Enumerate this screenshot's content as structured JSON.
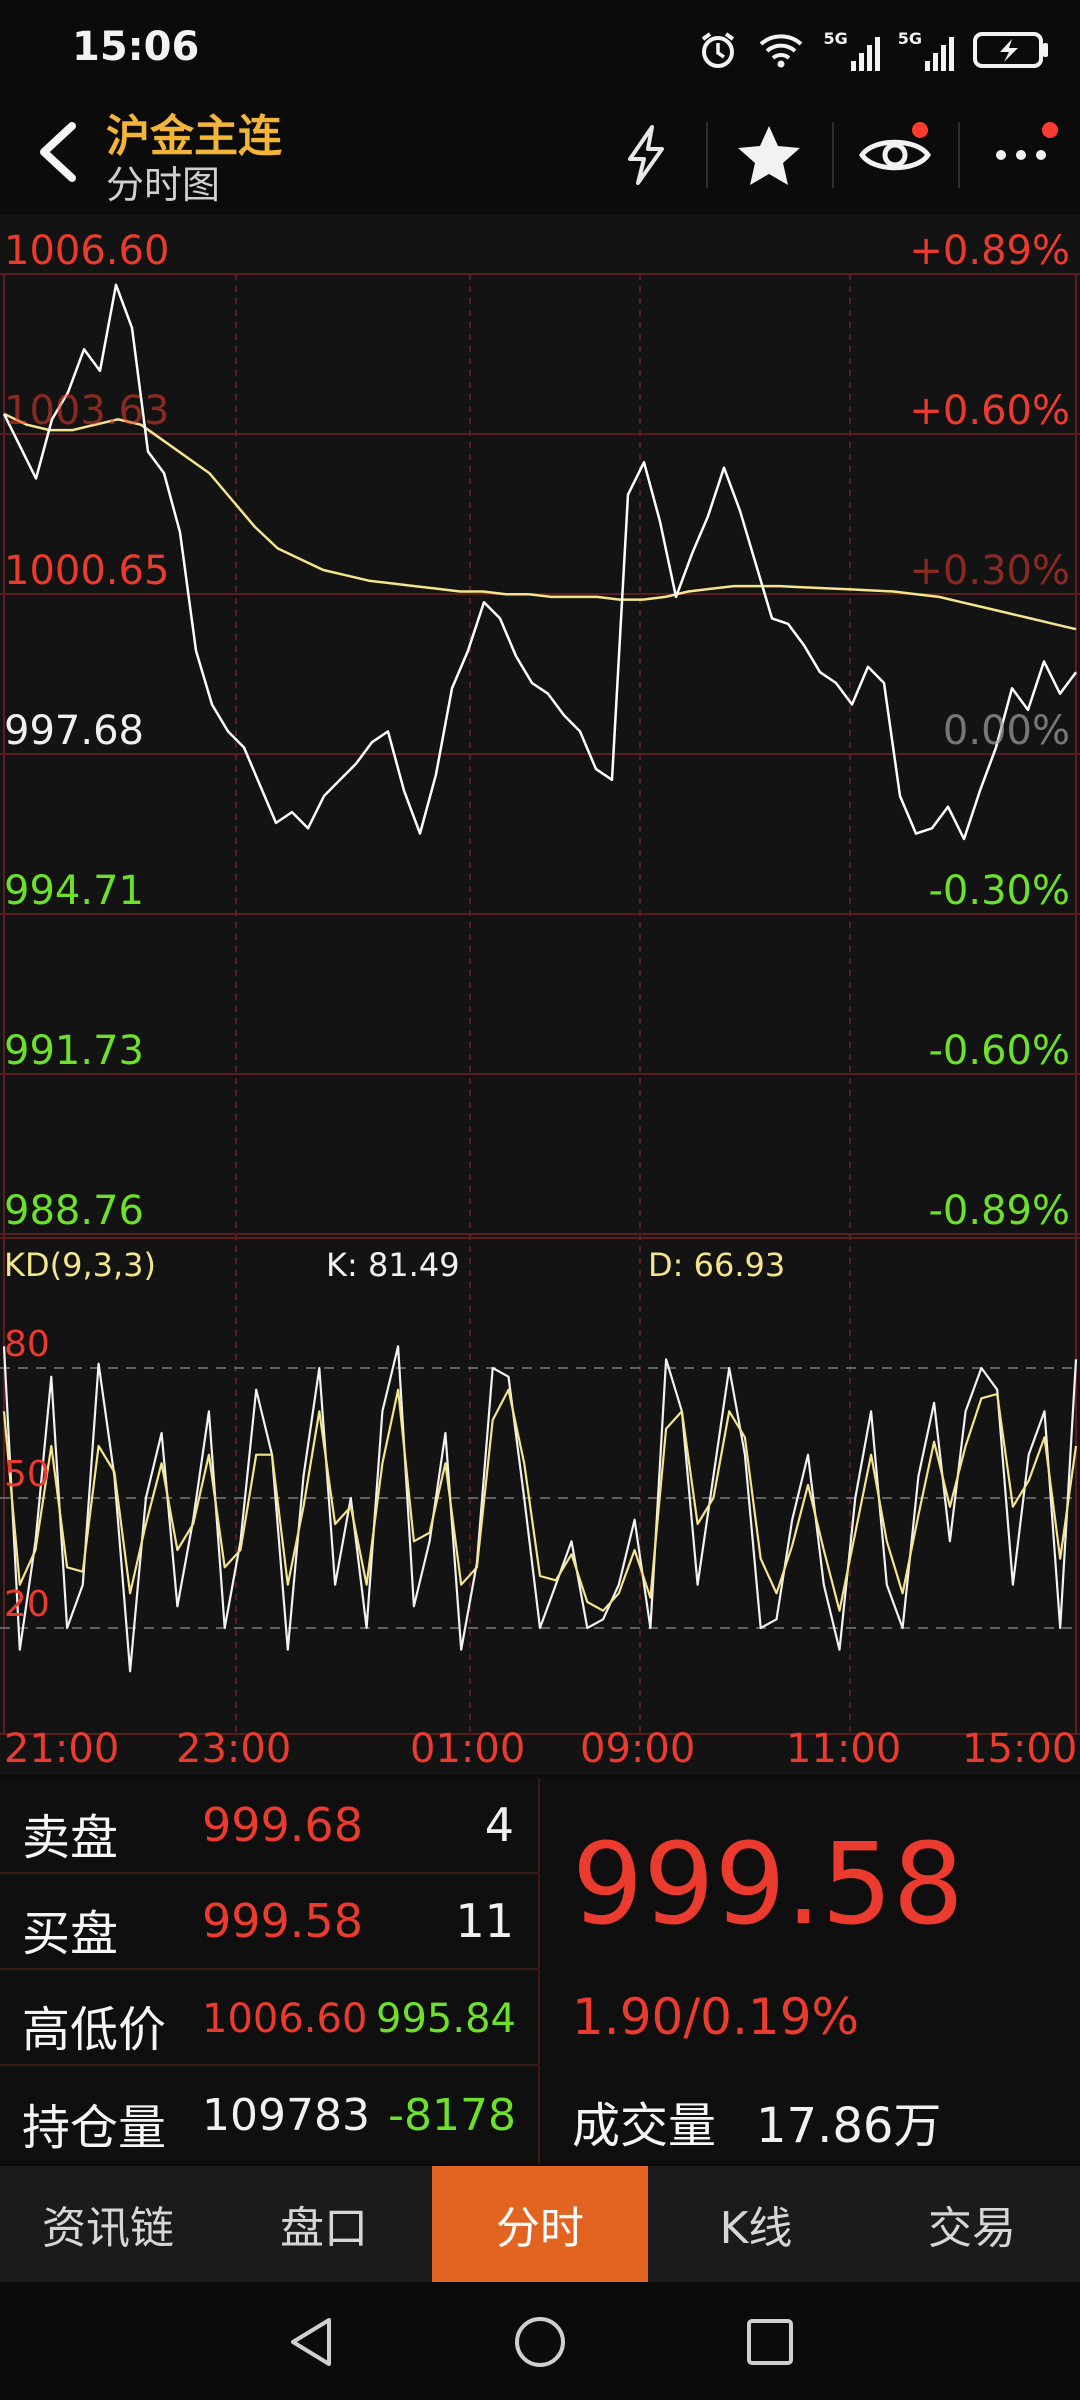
{
  "status_bar": {
    "time": "15:06",
    "signal_1": "5G",
    "signal_2": "5G"
  },
  "header": {
    "title": "沪金主连",
    "subtitle": "分时图",
    "icons": [
      "back-icon",
      "lightning-icon",
      "star-icon",
      "eye-icon",
      "more-icon"
    ]
  },
  "chart": {
    "y_left_labels": [
      "1006.60",
      "1003.63",
      "1000.65",
      "997.68",
      "994.71",
      "991.73",
      "988.76"
    ],
    "y_right_labels": [
      "+0.89%",
      "+0.60%",
      "+0.30%",
      "0.00%",
      "-0.30%",
      "-0.60%",
      "-0.89%"
    ],
    "indicator": {
      "name": "KD(9,3,3)",
      "k_label": "K: 81.49",
      "d_label": "D: 66.93",
      "levels": [
        "80",
        "50",
        "20"
      ]
    },
    "x_labels": [
      "21:00",
      "23:00",
      "01:00",
      "09:00",
      "11:00",
      "15:00"
    ]
  },
  "chart_data": [
    {
      "type": "line",
      "title": "",
      "ylim": [
        988.76,
        1006.6
      ],
      "x_ticks": [
        "21:00",
        "23:00",
        "01:00",
        "09:00",
        "11:00",
        "15:00"
      ],
      "reference_price": 997.68,
      "series": [
        {
          "values": [
            1004.0,
            1003.4,
            1002.8,
            1003.9,
            1004.4,
            1005.2,
            1004.8,
            1006.4,
            1005.6,
            1003.3,
            1002.9,
            1001.8,
            999.6,
            998.6,
            998.1,
            997.8,
            997.1,
            996.4,
            996.6,
            996.3,
            996.9,
            997.2,
            997.5,
            997.9,
            998.1,
            997.0,
            996.2,
            997.3,
            998.9,
            999.6,
            1000.5,
            1000.2,
            999.5,
            999.0,
            998.8,
            998.4,
            998.1,
            997.4,
            997.2,
            1002.5,
            1003.1,
            1002.0,
            1000.6,
            1001.4,
            1002.1,
            1003.0,
            1002.2,
            1001.2,
            1000.2,
            1000.1,
            999.7,
            999.2,
            999.0,
            998.6,
            999.3,
            999.0,
            996.9,
            996.2,
            996.3,
            996.7,
            996.1,
            997.0,
            997.8,
            998.9,
            998.5,
            999.4,
            998.8,
            999.2
          ]
        },
        {
          "values": [
            1004.0,
            1003.8,
            1003.7,
            1003.7,
            1003.8,
            1003.9,
            1003.8,
            1003.5,
            1003.2,
            1002.9,
            1002.4,
            1001.9,
            1001.5,
            1001.3,
            1001.1,
            1001.0,
            1000.9,
            1000.85,
            1000.8,
            1000.75,
            1000.7,
            1000.7,
            1000.65,
            1000.65,
            1000.6,
            1000.6,
            1000.6,
            1000.55,
            1000.55,
            1000.6,
            1000.7,
            1000.75,
            1000.8,
            1000.8,
            1000.8,
            1000.78,
            1000.76,
            1000.74,
            1000.72,
            1000.7,
            1000.65,
            1000.6,
            1000.5,
            1000.4,
            1000.3,
            1000.2,
            1000.1,
            1000.0
          ]
        }
      ]
    },
    {
      "type": "line",
      "title": "KD(9,3,3)",
      "ylim": [
        0,
        100
      ],
      "yticks": [
        20,
        50,
        80
      ],
      "series": [
        {
          "name": "K",
          "values": [
            85,
            15,
            40,
            78,
            20,
            30,
            81,
            55,
            10,
            50,
            65,
            25,
            45,
            70,
            20,
            40,
            75,
            60,
            15,
            55,
            80,
            30,
            50,
            20,
            70,
            85,
            25,
            40,
            65,
            15,
            35,
            80,
            78,
            50,
            20,
            30,
            40,
            20,
            22,
            30,
            45,
            20,
            82,
            70,
            30,
            55,
            80,
            60,
            20,
            22,
            45,
            60,
            30,
            15,
            50,
            70,
            30,
            20,
            55,
            72,
            40,
            70,
            80,
            75,
            30,
            60,
            70,
            20,
            82
          ]
        },
        {
          "name": "D",
          "values": [
            70,
            30,
            38,
            62,
            34,
            33,
            62,
            56,
            28,
            44,
            58,
            38,
            44,
            60,
            34,
            38,
            60,
            60,
            30,
            48,
            70,
            44,
            48,
            30,
            58,
            75,
            40,
            42,
            58,
            30,
            34,
            68,
            75,
            58,
            32,
            31,
            37,
            26,
            24,
            28,
            38,
            27,
            66,
            70,
            44,
            50,
            70,
            64,
            36,
            28,
            39,
            53,
            38,
            24,
            42,
            60,
            40,
            28,
            46,
            63,
            48,
            62,
            73,
            74,
            48,
            54,
            64,
            36,
            62
          ]
        }
      ]
    }
  ],
  "info": {
    "sell_label": "卖盘",
    "sell_price": "999.68",
    "sell_qty": "4",
    "buy_label": "买盘",
    "buy_price": "999.58",
    "buy_qty": "11",
    "hl_label": "高低价",
    "high": "1006.60",
    "low": "995.84",
    "oi_label": "持仓量",
    "oi_value": "109783",
    "oi_change": "-8178",
    "last_price": "999.58",
    "change": "1.90/0.19%",
    "volume_label": "成交量",
    "volume_value": "17.86万"
  },
  "tabs": [
    "资讯链",
    "盘口",
    "分时",
    "K线",
    "交易"
  ],
  "active_tab": "分时",
  "nav": [
    "back-nav-icon",
    "home-nav-icon",
    "recents-nav-icon"
  ],
  "colors": {
    "up": "#ea3b2e",
    "down": "#6de02a",
    "accent": "#f3b43a",
    "active_tab": "#e36321",
    "price_line": "#ffffff",
    "avg_line": "#f4e58c",
    "grid": "#5a1e1e"
  }
}
